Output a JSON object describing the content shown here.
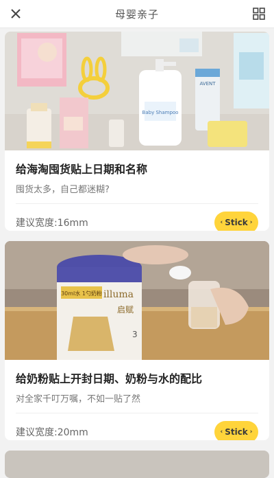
{
  "header": {
    "title": "母婴亲子"
  },
  "cards": [
    {
      "title": "给海淘囤货贴上日期和名称",
      "subtitle": "囤货太多，自己都迷糊?",
      "width_label": "建议宽度:16mm",
      "button": "Stick",
      "labels": [
        "Baby Shampoo",
        "AVENT"
      ]
    },
    {
      "title": "给奶粉贴上开封日期、奶粉与水的配比",
      "subtitle": "对全家千叮万嘱，不如一贴了然",
      "width_label": "建议宽度:20mm",
      "button": "Stick",
      "labels": [
        "illuma",
        "启赋"
      ]
    }
  ],
  "colors": {
    "accent": "#ffd43b",
    "background": "#f2f2f2"
  }
}
